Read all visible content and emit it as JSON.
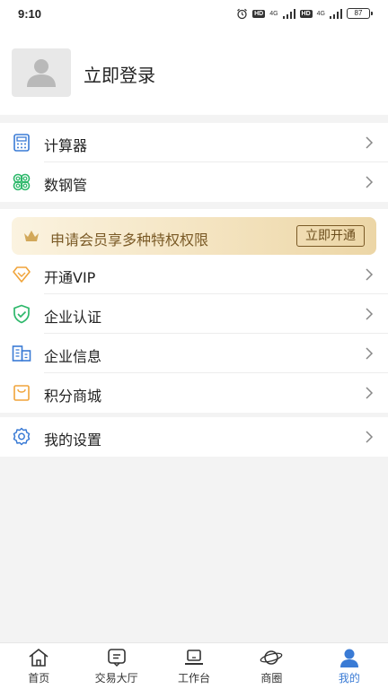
{
  "status_bar": {
    "time": "9:10",
    "hd1": "HD",
    "net1": "4G",
    "hd2": "HD",
    "net2": "4G",
    "battery": "87"
  },
  "profile": {
    "login_text": "立即登录"
  },
  "tools": [
    {
      "icon": "calculator-icon",
      "label": "计算器"
    },
    {
      "icon": "steel-pipe-icon",
      "label": "数钢管"
    }
  ],
  "vip_banner": {
    "text": "申请会员享多种特权权限",
    "button": "立即开通"
  },
  "services": [
    {
      "icon": "diamond-icon",
      "label": "开通VIP"
    },
    {
      "icon": "shield-check-icon",
      "label": "企业认证"
    },
    {
      "icon": "building-icon",
      "label": "企业信息"
    },
    {
      "icon": "shopping-bag-icon",
      "label": "积分商城"
    }
  ],
  "settings": [
    {
      "icon": "gear-icon",
      "label": "我的设置"
    }
  ],
  "tabbar": [
    {
      "icon": "home-icon",
      "label": "首页",
      "active": false
    },
    {
      "icon": "message-icon",
      "label": "交易大厅",
      "active": false
    },
    {
      "icon": "laptop-icon",
      "label": "工作台",
      "active": false
    },
    {
      "icon": "planet-icon",
      "label": "商圈",
      "active": false
    },
    {
      "icon": "user-icon",
      "label": "我的",
      "active": true
    }
  ],
  "colors": {
    "accent": "#3a7bd5",
    "vip_gold": "#7a5a26",
    "icon_blue": "#3a7bd5",
    "icon_green": "#2eb86b",
    "icon_orange": "#f0a43a"
  }
}
